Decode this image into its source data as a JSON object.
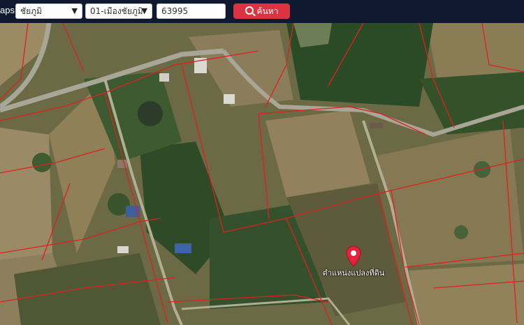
{
  "header": {
    "brand_fragment": "aps",
    "province_select": {
      "value": "ชัยภูมิ"
    },
    "district_select": {
      "value": "01-เมืองชัยภูมิ"
    },
    "postal_input": {
      "value": "63995"
    },
    "search_button": {
      "label": "ค้นหา",
      "icon": "search-icon"
    }
  },
  "map": {
    "view": "satellite",
    "parcel_line_color": "#e02020",
    "marker": {
      "icon": "map-pin-icon",
      "color": "#e8203b",
      "label": "ตำแหน่งแปลงที่ดิน"
    }
  }
}
